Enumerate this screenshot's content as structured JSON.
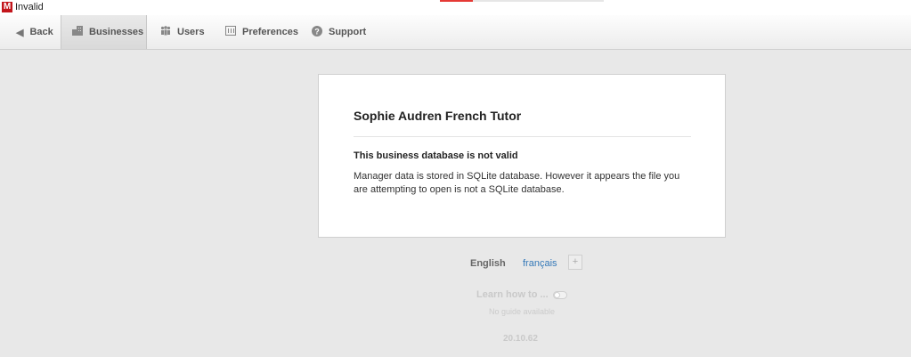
{
  "window": {
    "title": "Invalid",
    "app_icon": "M",
    "accent_color": "#c3161c"
  },
  "toolbar": {
    "back": {
      "label": "Back",
      "icon": "triangle-left-icon"
    },
    "tabs": [
      {
        "label": "Businesses",
        "icon": "buildings-icon",
        "active": true
      },
      {
        "label": "Users",
        "icon": "users-icon",
        "active": false
      },
      {
        "label": "Preferences",
        "icon": "preferences-icon",
        "active": false
      },
      {
        "label": "Support",
        "icon": "question-circle-icon",
        "active": false
      }
    ]
  },
  "card": {
    "title": "Sophie Audren French Tutor",
    "heading": "This business database is not valid",
    "body": "Manager data is stored in SQLite database. However it appears the file you are attempting to open is not a SQLite database."
  },
  "footer": {
    "languages": [
      "English",
      "français"
    ],
    "selected_language": "English",
    "add_language_label": "+",
    "learn_label": "Learn how to ...",
    "no_guide": "No guide available",
    "version": "20.10.62"
  }
}
